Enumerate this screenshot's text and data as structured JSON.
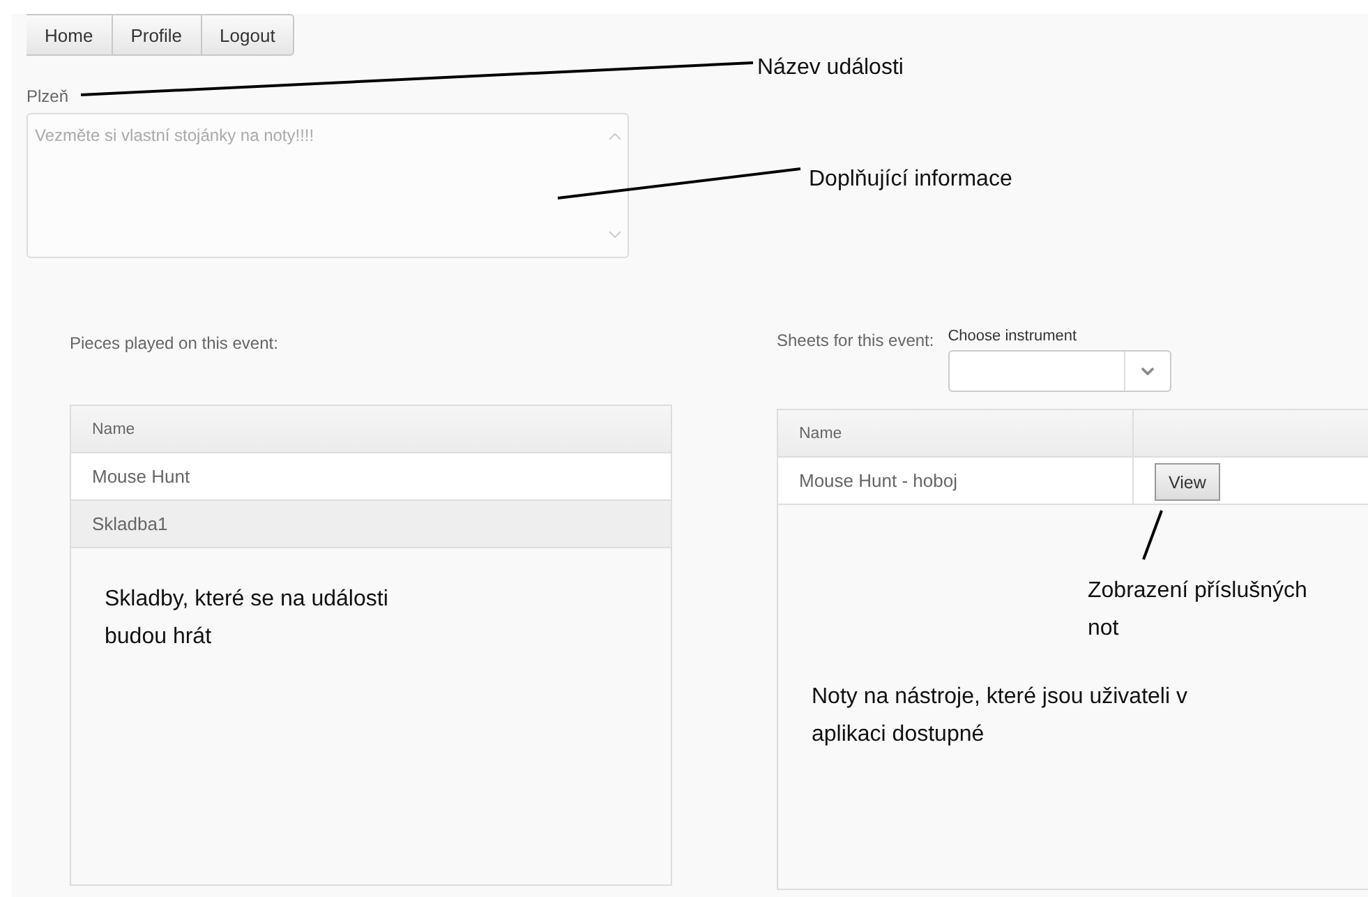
{
  "nav": [
    "Home",
    "Profile",
    "Logout"
  ],
  "event": {
    "name": "Plzeň",
    "info": "Vezměte si vlastní stojánky na noty!!!!"
  },
  "pieces": {
    "label": "Pieces played on this event:",
    "columns": [
      "Name"
    ],
    "rows": [
      "Mouse Hunt",
      "Skladba1"
    ]
  },
  "sheets": {
    "label": "Sheets for this event:",
    "instrument_label": "Choose instrument",
    "columns": [
      "Name"
    ],
    "rows": [
      {
        "name": "Mouse Hunt - hoboj",
        "action": "View"
      }
    ]
  },
  "annotations": [
    {
      "text": "Název události"
    },
    {
      "text": "Doplňující informace"
    },
    {
      "text": "Skladby, které se na události budou hrát"
    },
    {
      "text": "Zobrazení příslušných not"
    },
    {
      "text": "Noty na nástroje, které jsou uživateli v aplikaci dostupné"
    }
  ]
}
